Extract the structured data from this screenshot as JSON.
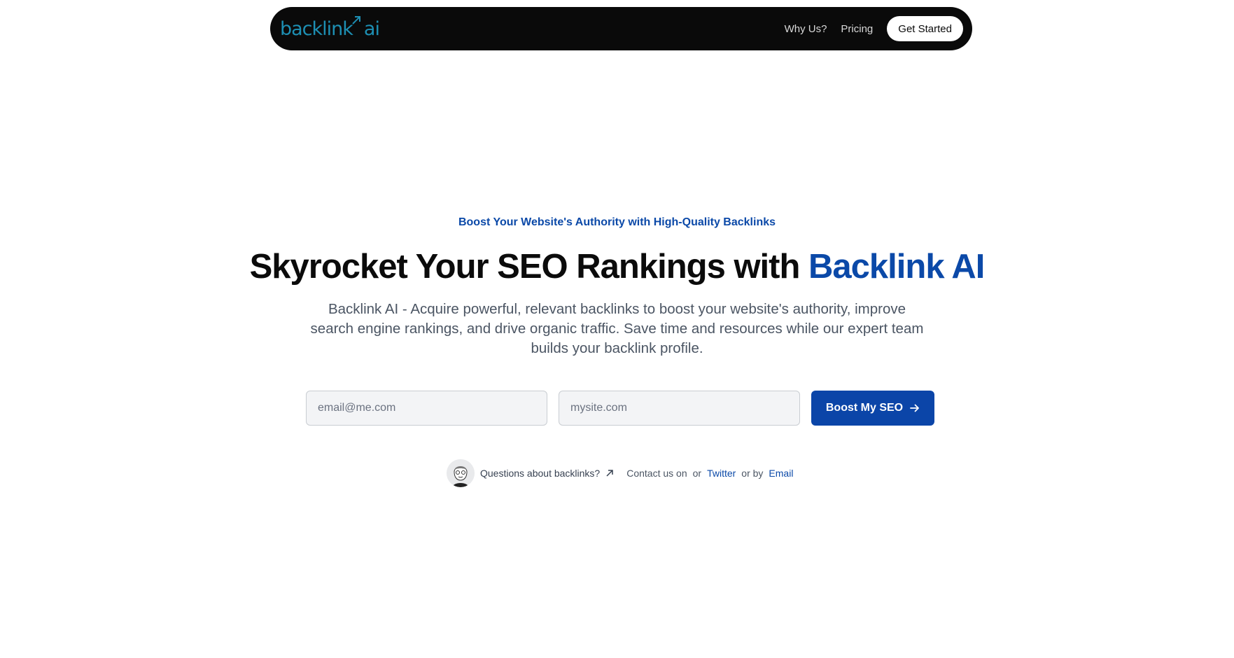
{
  "nav": {
    "logo_text": "backlink",
    "logo_suffix": "ai",
    "links": [
      "Why Us?",
      "Pricing"
    ],
    "cta_label": "Get Started"
  },
  "hero": {
    "eyebrow": "Boost Your Website's Authority with High-Quality Backlinks",
    "headline_main": "Skyrocket Your SEO Rankings with ",
    "headline_accent": "Backlink AI",
    "subtitle": "Backlink AI - Acquire powerful, relevant backlinks to boost your website's authority, improve search engine rankings, and drive organic traffic. Save time and resources while our expert team builds your backlink profile."
  },
  "form": {
    "email_placeholder": "email@me.com",
    "site_placeholder": "mysite.com",
    "submit_label": "Boost My SEO"
  },
  "contact": {
    "question": "Questions about backlinks?",
    "prefix": "Contact us on",
    "or1": "or",
    "twitter": "Twitter",
    "or2": "or by",
    "email": "Email"
  },
  "colors": {
    "accent": "#0b49a8",
    "logo": "#1d8fb3",
    "nav_bg": "#0a0a0a"
  },
  "icons": {
    "logo_arrow": "arrow-up-right-icon",
    "submit": "arrow-right-icon",
    "external": "arrow-up-right-icon"
  }
}
